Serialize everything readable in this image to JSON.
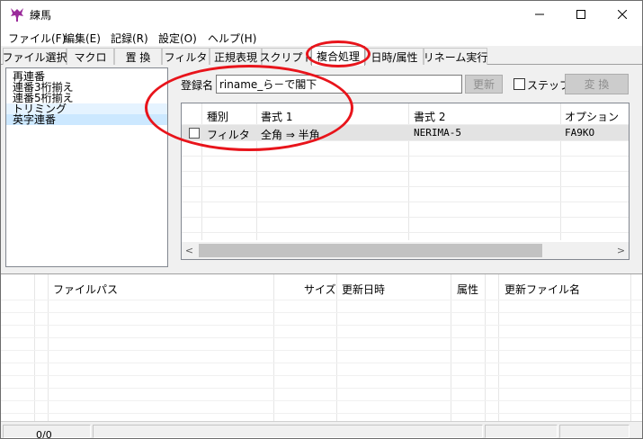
{
  "window": {
    "title": "練馬",
    "minimize_glyph": "—",
    "maximize_glyph": "☐",
    "close_glyph": "✕"
  },
  "menu": [
    "ファイル(F)",
    "編集(E)",
    "記録(R)",
    "設定(O)",
    "ヘルプ(H)"
  ],
  "tabs": [
    "ファイル選択",
    "マクロ",
    "置 換",
    "フィルタ",
    "正規表現",
    "スクリプト",
    "複合処理",
    "日時/属性",
    "リネーム実行"
  ],
  "name_list": [
    "再連番",
    "連番3桁揃え",
    "連番5桁揃え",
    "トリミング",
    "英字連番"
  ],
  "register": {
    "label": "登録名",
    "value": "riname_ら－で閣下",
    "update_label": "更新",
    "step_label": "ステップ",
    "convert_label": "変 換"
  },
  "grid": {
    "headers": [
      "種別",
      "書式 1",
      "書式 2",
      "オプション"
    ],
    "row": {
      "type": "フィルタ",
      "format1": "全角 ⇒ 半角",
      "format2": "NERIMA-5",
      "option": "FA9KO"
    },
    "scroll_left": "<",
    "scroll_right": ">"
  },
  "file_table": {
    "headers": [
      "ファイルパス",
      "サイズ",
      "更新日時",
      "属性",
      "更新ファイル名"
    ]
  },
  "status": {
    "count": "0/0"
  },
  "colors": {
    "annotation": "#e8141b",
    "selected": "#cce8ff",
    "app_icon": "#9b2c9b"
  }
}
